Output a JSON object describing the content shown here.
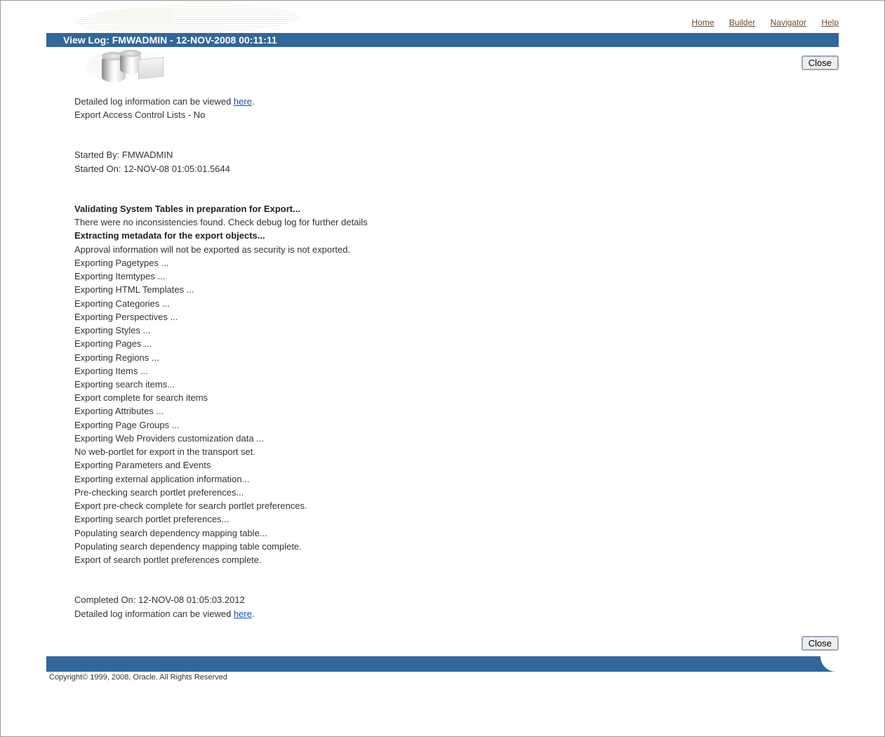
{
  "nav": {
    "home": "Home",
    "builder": "Builder",
    "navigator": "Navigator",
    "help": "Help"
  },
  "title": "View Log: FMWADMIN - 12-NOV-2008 00:11:11",
  "close_label": "Close",
  "intro": {
    "line1_prefix": "Detailed log information can be viewed ",
    "here": "here",
    "line1_suffix": ".",
    "line2": "Export Access Control Lists - No"
  },
  "started": {
    "by": "Started By: FMWADMIN",
    "on": "Started On: 12-NOV-08 01:05:01.5644"
  },
  "section1_header": "Validating System Tables in preparation for Export...",
  "section1_line": "There were no inconsistencies found. Check debug log for further details",
  "section2_header": "Extracting metadata for the export objects...",
  "log_lines": [
    "Approval information will not be exported as security is not exported.",
    "Exporting Pagetypes ...",
    "Exporting Itemtypes ...",
    "Exporting HTML Templates ...",
    "Exporting Categories ...",
    "Exporting Perspectives ...",
    "Exporting Styles ...",
    "Exporting Pages ...",
    "Exporting Regions ...",
    "Exporting Items ...",
    "Exporting search items...",
    "Export complete for search items",
    "Exporting Attributes ...",
    "Exporting Page Groups ...",
    "Exporting Web Providers customization data ...",
    "No web-portlet for export in the transport set.",
    "Exporting Parameters and Events",
    "Exporting external application information...",
    "Pre-checking search portlet preferences...",
    "Export pre-check complete for search portlet preferences.",
    "Exporting search portlet preferences...",
    "Populating search dependency mapping table...",
    "Populating search dependency mapping table complete.",
    "Export of search portlet preferences complete."
  ],
  "completed": {
    "on": "Completed On: 12-NOV-08 01:05:03.2012",
    "line_prefix": "Detailed log information can be viewed ",
    "here": "here",
    "line_suffix": "."
  },
  "copyright": "Copyright© 1999, 2008, Oracle. All Rights Reserved"
}
